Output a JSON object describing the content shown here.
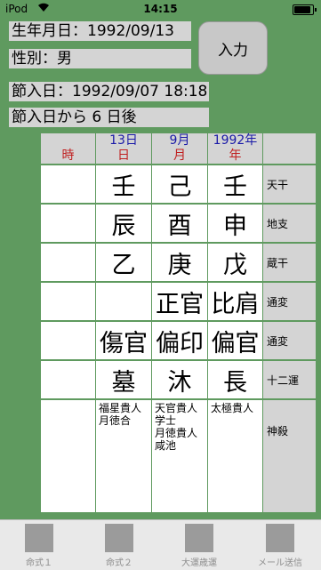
{
  "status": {
    "carrier": "iPod",
    "wifi_icon": "wifi-icon",
    "time": "14:15",
    "battery_icon": "battery-icon"
  },
  "info": {
    "birth": "生年月日：1992/09/13",
    "gender": "性別：男",
    "setsu": "節入日：1992/09/07 18:18",
    "after": "節入日から 6 日後"
  },
  "input_button": "入力",
  "table": {
    "header_top": [
      "",
      "13日",
      "9月",
      "1992年"
    ],
    "header_bottom": [
      "時",
      "日",
      "月",
      "年"
    ],
    "rows": [
      {
        "cells": [
          "",
          "壬",
          "己",
          "壬"
        ],
        "label": "天干"
      },
      {
        "cells": [
          "",
          "辰",
          "酉",
          "申"
        ],
        "label": "地支"
      },
      {
        "cells": [
          "",
          "乙",
          "庚",
          "戊"
        ],
        "label": "蔵干"
      },
      {
        "cells": [
          "",
          "",
          "正官",
          "比肩"
        ],
        "label": "通変"
      },
      {
        "cells": [
          "",
          "傷官",
          "偏印",
          "偏官"
        ],
        "label": "通変"
      },
      {
        "cells": [
          "",
          "墓",
          "沐",
          "長"
        ],
        "label": "十二運"
      }
    ],
    "shinsatsu": {
      "cells": [
        [],
        [
          "福星貴人",
          "月徳合"
        ],
        [
          "天官貴人",
          "学士",
          "月徳貴人",
          "咸池"
        ],
        [
          "太極貴人"
        ]
      ],
      "label": "神殺"
    }
  },
  "tabs": [
    {
      "label": "命式１",
      "active": true
    },
    {
      "label": "命式２",
      "active": false
    },
    {
      "label": "大運歳運",
      "active": false
    },
    {
      "label": "メール送信",
      "active": false
    }
  ],
  "colors": {
    "background": "#5f9a5f",
    "accent": "#2a8bf2",
    "header_day": "#1a1aa8",
    "header_pillar": "#c02020"
  }
}
